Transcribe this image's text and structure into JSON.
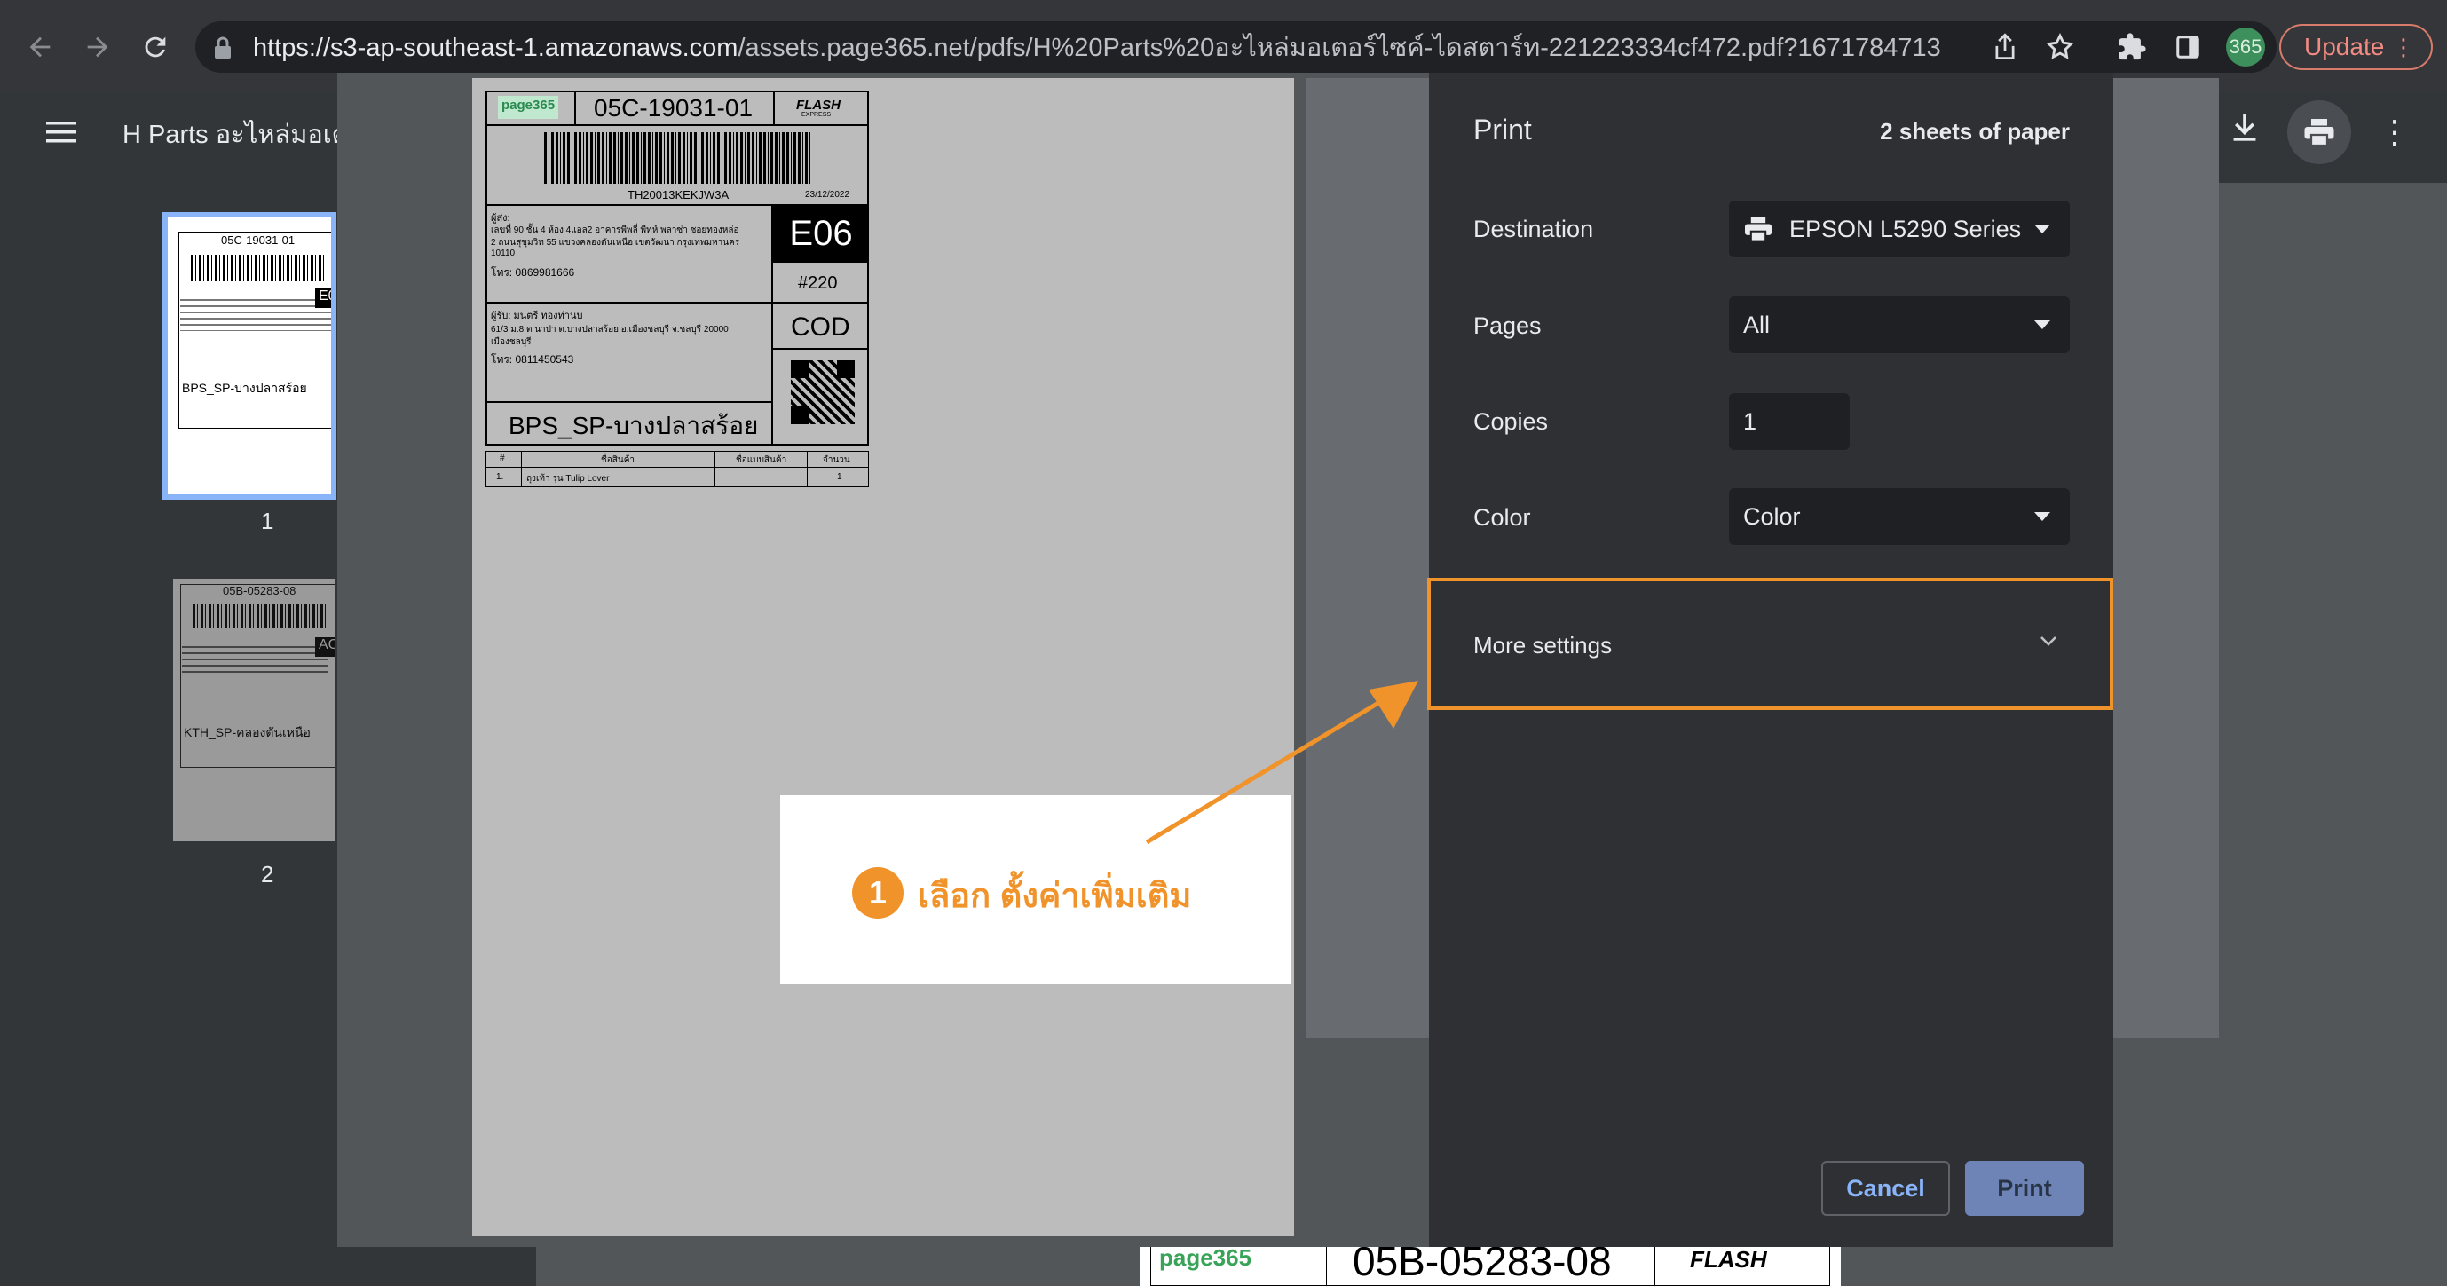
{
  "browser": {
    "url_host": "https://s3-ap-southeast-1.amazonaws.com",
    "url_path": "/assets.page365.net/pdfs/H%20Parts%20อะไหล่มอเตอร์ไซค์-ไดสตาร์ท-221223334cf472.pdf?1671784713",
    "avatar_text": "365",
    "update_label": "Update"
  },
  "pdf_viewer": {
    "title": "H Parts อะไหล่มอเต",
    "thumbnails": [
      {
        "page": "1",
        "code": "05C-19031-01",
        "destination": "BPS_SP-บางปลาสร้อย"
      },
      {
        "page": "2",
        "code": "05B-05283-08",
        "destination": "KTH_SP-คลองตันเหนือ"
      }
    ],
    "bottom_code": "05B-05283-08"
  },
  "print_dialog": {
    "title": "Print",
    "sheets": "2 sheets of paper",
    "destination_label": "Destination",
    "destination_value": "EPSON L5290 Series",
    "pages_label": "Pages",
    "pages_value": "All",
    "copies_label": "Copies",
    "copies_value": "1",
    "color_label": "Color",
    "color_value": "Color",
    "more_settings_label": "More settings",
    "cancel_label": "Cancel",
    "print_label": "Print"
  },
  "shipping_label": {
    "brand": "page365",
    "code": "05C-19031-01",
    "carrier": "FLASH",
    "carrier_sub": "EXPRESS",
    "tracking": "TH20013KEKJW3A",
    "date": "23/12/2022",
    "sender_heading": "ผู้ส่ง:",
    "sender_address_1": "เลขที่ 90 ชั้น 4 ห้อง 4แอล2 อาคารพีพลี่ พีทห์ พลาซ่า ซอยทองหล่อ",
    "sender_address_2": "2 ถนนสุขุมวิท 55 แขวงคลองตันเหนือ เขตวัฒนา กรุงเทพมหานคร",
    "sender_address_3": "10110",
    "sender_phone": "โทร: 0869981666",
    "sort_code": "E06",
    "route": "#220",
    "receiver_heading": "ผู้รับ: มนตรี ทองท่านบ",
    "receiver_address_1": "61/3 ม.8 ต นาป่า ต.บางปลาสร้อย อ.เมืองชลบุรี จ.ชลบุรี 20000",
    "receiver_address_2": "เมืองชลบุรี",
    "receiver_phone": "โทร: 0811450543",
    "payment": "COD",
    "destination": "BPS_SP-บางปลาสร้อย",
    "table_headers": [
      "#",
      "ชื่อสินค้า",
      "ชื่อแบบสินค้า",
      "จำนวน"
    ],
    "table_row": [
      "1.",
      "ถุงเท้า รุ่น Tulip Lover",
      "",
      "1"
    ]
  },
  "annotation": {
    "step_number": "1",
    "text": "เลือก ตั้งค่าเพิ่มเติม",
    "accent": "#f0932b"
  },
  "colors": {
    "primary_button": "#8ab4f8",
    "highlight": "#f0932b"
  }
}
